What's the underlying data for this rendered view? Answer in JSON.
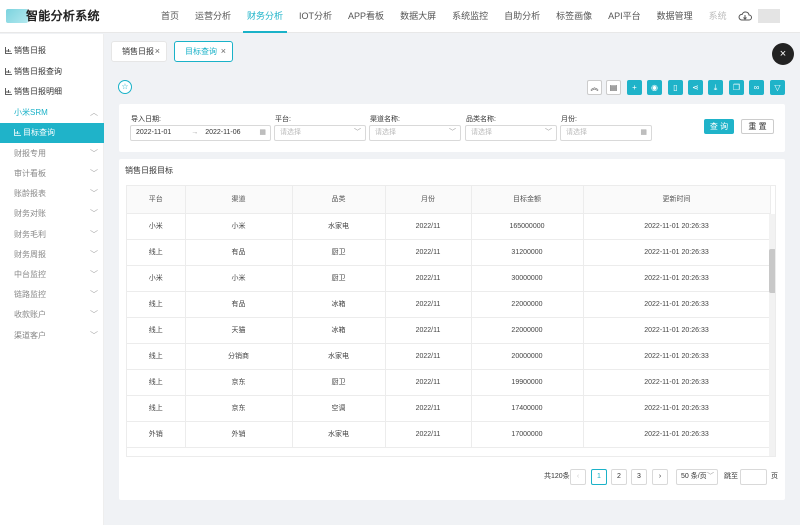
{
  "app": {
    "title": "智能分析系统"
  },
  "top_nav": [
    "首页",
    "运营分析",
    "财务分析",
    "IOT分析",
    "APP看板",
    "数据大屏",
    "系统监控",
    "自助分析",
    "标签画像",
    "API平台",
    "数据管理",
    "系统"
  ],
  "sidebar": {
    "items": [
      {
        "label": "销售日报"
      },
      {
        "label": "销售日报查询"
      },
      {
        "label": "销售日报明细"
      },
      {
        "label": "小米SRM"
      },
      {
        "label": "目标查询"
      },
      {
        "label": "财报专用"
      },
      {
        "label": "审计看板"
      },
      {
        "label": "账龄报表"
      },
      {
        "label": "财务对账"
      },
      {
        "label": "财务毛利"
      },
      {
        "label": "财务周报"
      },
      {
        "label": "中台监控"
      },
      {
        "label": "链路监控"
      },
      {
        "label": "收款账户"
      },
      {
        "label": "渠道客户"
      }
    ]
  },
  "tabs": [
    {
      "label": "销售日报"
    },
    {
      "label": "目标查询"
    }
  ],
  "filters": {
    "import_date_label": "导入日期:",
    "date_start": "2022-11-01",
    "date_end": "2022-11-06",
    "platform_label": "平台:",
    "platform_placeholder": "请选择",
    "channel_label": "渠道名称:",
    "channel_placeholder": "请选择",
    "category_label": "品类名称:",
    "category_placeholder": "请选择",
    "month_label": "月份:",
    "month_placeholder": "请选择",
    "query_label": "查 询",
    "reset_label": "重 置"
  },
  "table": {
    "title": "销售日报目标",
    "columns": [
      "平台",
      "渠道",
      "品类",
      "月份",
      "目标金额",
      "更新时间"
    ],
    "rows": [
      [
        "小米",
        "小米",
        "水家电",
        "2022/11",
        "165000000",
        "2022-11-01 20:26:33"
      ],
      [
        "线上",
        "有品",
        "厨卫",
        "2022/11",
        "31200000",
        "2022-11-01 20:26:33"
      ],
      [
        "小米",
        "小米",
        "厨卫",
        "2022/11",
        "30000000",
        "2022-11-01 20:26:33"
      ],
      [
        "线上",
        "有品",
        "冰箱",
        "2022/11",
        "22000000",
        "2022-11-01 20:26:33"
      ],
      [
        "线上",
        "天猫",
        "冰箱",
        "2022/11",
        "22000000",
        "2022-11-01 20:26:33"
      ],
      [
        "线上",
        "分销商",
        "水家电",
        "2022/11",
        "20000000",
        "2022-11-01 20:26:33"
      ],
      [
        "线上",
        "京东",
        "厨卫",
        "2022/11",
        "19900000",
        "2022-11-01 20:26:33"
      ],
      [
        "线上",
        "京东",
        "空调",
        "2022/11",
        "17400000",
        "2022-11-01 20:26:33"
      ],
      [
        "外销",
        "外销",
        "水家电",
        "2022/11",
        "17000000",
        "2022-11-01 20:26:33"
      ]
    ]
  },
  "pagination": {
    "total": "共120条",
    "pages": [
      "1",
      "2",
      "3"
    ],
    "page_size": "50 条/页",
    "goto_label": "跳至",
    "page_label": "页"
  },
  "colors": {
    "accent": "#1fb3c9"
  }
}
